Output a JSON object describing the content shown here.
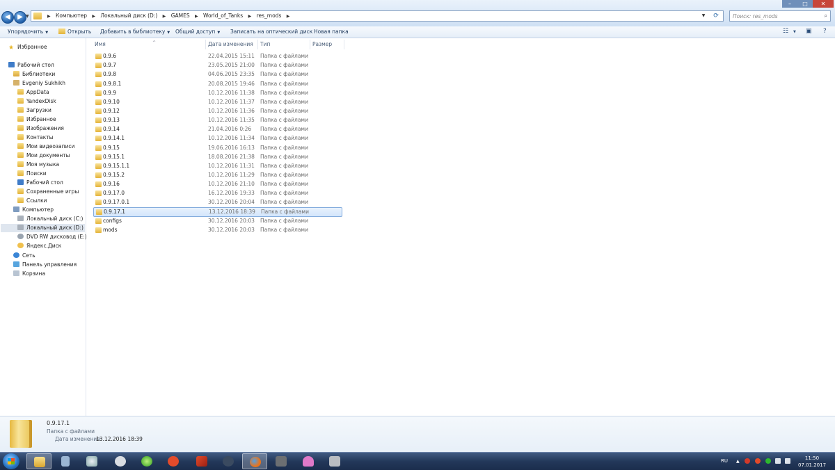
{
  "window": {
    "breadcrumbs": [
      "Компьютер",
      "Локальный диск (D:)",
      "GAMES",
      "World_of_Tanks",
      "res_mods"
    ],
    "search_placeholder": "Поиск: res_mods",
    "controls": {
      "minimize": "–",
      "maximize": "□",
      "close": "✕"
    }
  },
  "toolbar": {
    "organize": "Упорядочить",
    "open": "Открыть",
    "add_to_library": "Добавить в библиотеку",
    "share": "Общий доступ",
    "burn": "Записать на оптический диск",
    "new_folder": "Новая папка"
  },
  "sidebar": {
    "favorites": "Избранное",
    "desktop": "Рабочий стол",
    "libraries": "Библиотеки",
    "user": "Evgeniy Sukhikh",
    "user_items": [
      "AppData",
      "YandexDisk",
      "Загрузки",
      "Избранное",
      "Изображения",
      "Контакты",
      "Мои видеозаписи",
      "Мои документы",
      "Моя музыка",
      "Поиски",
      "Рабочий стол",
      "Сохраненные игры",
      "Ссылки"
    ],
    "computer": "Компьютер",
    "drives": [
      "Локальный диск (C:)",
      "Локальный диск (D:)",
      "DVD RW дисковод (E:)",
      "Яндекс.Диск"
    ],
    "network": "Сеть",
    "control_panel": "Панель управления",
    "recycle_bin": "Корзина"
  },
  "columns": {
    "name": "Имя",
    "date": "Дата изменения",
    "type": "Тип",
    "size": "Размер"
  },
  "files": [
    {
      "name": "0.9.6",
      "date": "22.04.2015 15:11",
      "type": "Папка с файлами"
    },
    {
      "name": "0.9.7",
      "date": "23.05.2015 21:00",
      "type": "Папка с файлами"
    },
    {
      "name": "0.9.8",
      "date": "04.06.2015 23:35",
      "type": "Папка с файлами"
    },
    {
      "name": "0.9.8.1",
      "date": "20.08.2015 19:46",
      "type": "Папка с файлами"
    },
    {
      "name": "0.9.9",
      "date": "10.12.2016 11:38",
      "type": "Папка с файлами"
    },
    {
      "name": "0.9.10",
      "date": "10.12.2016 11:37",
      "type": "Папка с файлами"
    },
    {
      "name": "0.9.12",
      "date": "10.12.2016 11:36",
      "type": "Папка с файлами"
    },
    {
      "name": "0.9.13",
      "date": "10.12.2016 11:35",
      "type": "Папка с файлами"
    },
    {
      "name": "0.9.14",
      "date": "21.04.2016 0:26",
      "type": "Папка с файлами"
    },
    {
      "name": "0.9.14.1",
      "date": "10.12.2016 11:34",
      "type": "Папка с файлами"
    },
    {
      "name": "0.9.15",
      "date": "19.06.2016 16:13",
      "type": "Папка с файлами"
    },
    {
      "name": "0.9.15.1",
      "date": "18.08.2016 21:38",
      "type": "Папка с файлами"
    },
    {
      "name": "0.9.15.1.1",
      "date": "10.12.2016 11:31",
      "type": "Папка с файлами"
    },
    {
      "name": "0.9.15.2",
      "date": "10.12.2016 11:29",
      "type": "Папка с файлами"
    },
    {
      "name": "0.9.16",
      "date": "10.12.2016 21:10",
      "type": "Папка с файлами"
    },
    {
      "name": "0.9.17.0",
      "date": "16.12.2016 19:33",
      "type": "Папка с файлами"
    },
    {
      "name": "0.9.17.0.1",
      "date": "30.12.2016 20:04",
      "type": "Папка с файлами"
    },
    {
      "name": "0.9.17.1",
      "date": "13.12.2016 18:39",
      "type": "Папка с файлами",
      "selected": true
    },
    {
      "name": "configs",
      "date": "30.12.2016 20:03",
      "type": "Папка с файлами"
    },
    {
      "name": "mods",
      "date": "30.12.2016 20:03",
      "type": "Папка с файлами"
    }
  ],
  "details": {
    "name": "0.9.17.1",
    "type": "Папка с файлами",
    "modified_label": "Дата изменения:",
    "modified_value": "13.12.2016 18:39"
  },
  "taskbar": {
    "language": "RU",
    "time": "11:50",
    "date": "07.01.2017",
    "apps": [
      "explorer-icon",
      "calculator-icon",
      "ccleaner-icon",
      "foobar-icon",
      "utorrent-icon",
      "opera-icon",
      "wargaming-icon",
      "hexchat-icon",
      "firefox-icon",
      "world-of-tanks-icon",
      "octopus-icon",
      "rom-icon"
    ]
  },
  "colors": {
    "selection": "#d3e6fb",
    "selection_border": "#84acdd",
    "folder": "#e4b43a",
    "taskbar": "#23385a"
  }
}
